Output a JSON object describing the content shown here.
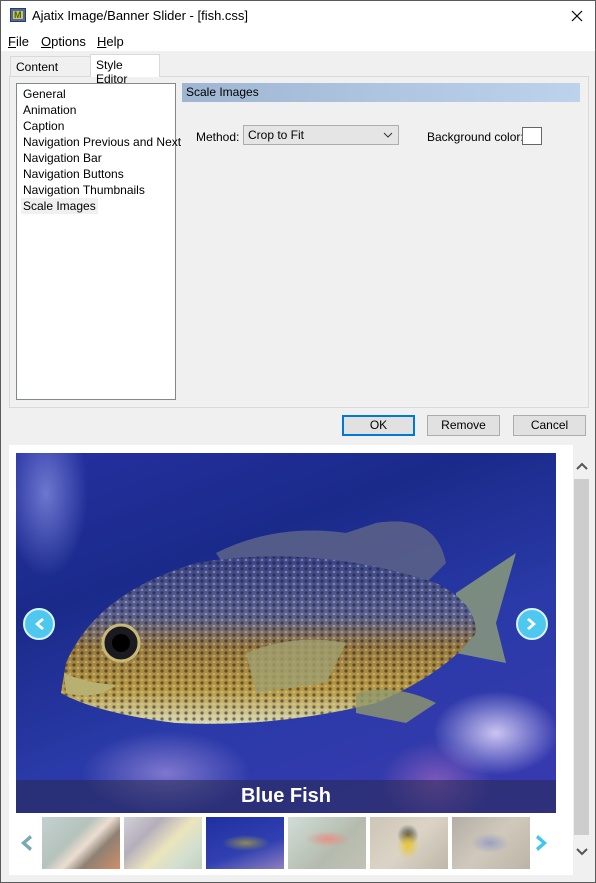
{
  "window": {
    "title": "Ajatix Image/Banner Slider - [fish.css]",
    "close_icon": "close-icon"
  },
  "menu": {
    "items": [
      {
        "label": "File",
        "accel": "F",
        "rest": "ile"
      },
      {
        "label": "Options",
        "accel": "O",
        "rest": "ptions"
      },
      {
        "label": "Help",
        "accel": "H",
        "rest": "elp"
      }
    ]
  },
  "tabs": [
    {
      "label": "Content Editor",
      "active": false
    },
    {
      "label": "Style Editor",
      "active": true
    }
  ],
  "style_list": {
    "items": [
      "General",
      "Animation",
      "Caption",
      "Navigation Previous and Next",
      "Navigation Bar",
      "Navigation Buttons",
      "Navigation Thumbnails",
      "Scale Images"
    ],
    "selected": "Scale Images"
  },
  "section": {
    "title": "Scale Images",
    "method_label": "Method:",
    "method_value": "Crop to Fit",
    "bgcolor_label": "Background color:",
    "bgcolor_value": "#ffffff"
  },
  "buttons": {
    "ok": "OK",
    "remove": "Remove",
    "cancel": "Cancel"
  },
  "preview": {
    "caption": "Blue Fish",
    "prev_icon": "chevron-left-circle-icon",
    "next_icon": "chevron-right-circle-icon",
    "thumbnails": [
      {
        "name": "butterflyfish",
        "active": false
      },
      {
        "name": "coral-fish",
        "active": false
      },
      {
        "name": "blue-fish",
        "active": true
      },
      {
        "name": "red-fish",
        "active": false
      },
      {
        "name": "clownfish",
        "active": false
      },
      {
        "name": "blue-tang",
        "active": false
      }
    ],
    "accent_color": "#4fc8f0"
  }
}
